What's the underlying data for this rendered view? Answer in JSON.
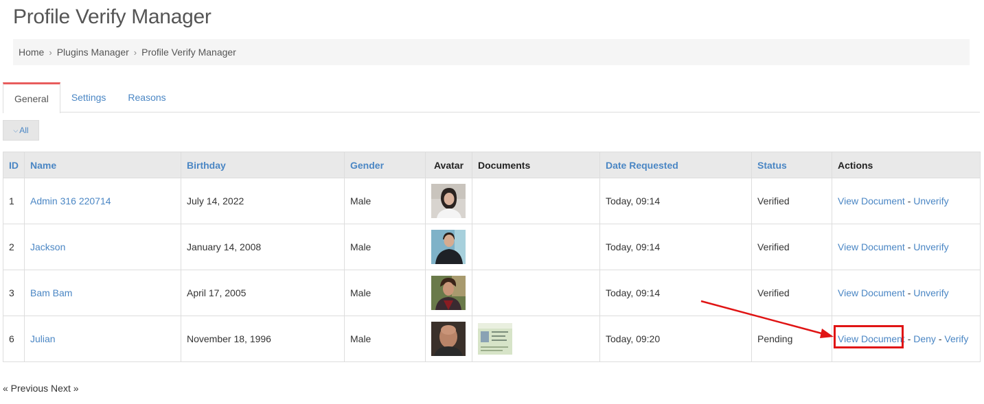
{
  "page": {
    "title": "Profile Verify Manager"
  },
  "breadcrumb": [
    "Home",
    "Plugins Manager",
    "Profile Verify Manager"
  ],
  "tabs": [
    {
      "label": "General",
      "active": true
    },
    {
      "label": "Settings",
      "active": false
    },
    {
      "label": "Reasons",
      "active": false
    }
  ],
  "filter": {
    "label": "All",
    "icon": "chevron-down-icon"
  },
  "table": {
    "columns": [
      "ID",
      "Name",
      "Birthday",
      "Gender",
      "Avatar",
      "Documents",
      "Date Requested",
      "Status",
      "Actions"
    ],
    "rows": [
      {
        "id": "1",
        "name": "Admin 316 220714",
        "birthday": "July 14, 2022",
        "gender": "Male",
        "has_document": false,
        "date": "Today, 09:14",
        "status": "Verified",
        "actions": [
          "View Document",
          "Unverify"
        ]
      },
      {
        "id": "2",
        "name": "Jackson",
        "birthday": "January 14, 2008",
        "gender": "Male",
        "has_document": false,
        "date": "Today, 09:14",
        "status": "Verified",
        "actions": [
          "View Document",
          "Unverify"
        ]
      },
      {
        "id": "3",
        "name": "Bam Bam",
        "birthday": "April 17, 2005",
        "gender": "Male",
        "has_document": false,
        "date": "Today, 09:14",
        "status": "Verified",
        "actions": [
          "View Document",
          "Unverify"
        ]
      },
      {
        "id": "6",
        "name": "Julian",
        "birthday": "November 18, 1996",
        "gender": "Male",
        "has_document": true,
        "date": "Today, 09:20",
        "status": "Pending",
        "actions": [
          "View Document",
          "Deny",
          "Verify"
        ]
      }
    ],
    "action_separator": "-"
  },
  "pager": {
    "previous": "« Previous",
    "next": "Next »"
  },
  "colors": {
    "link": "#4a86c4",
    "active_tab_border": "#e85c5c",
    "annotation": "#e01414"
  }
}
